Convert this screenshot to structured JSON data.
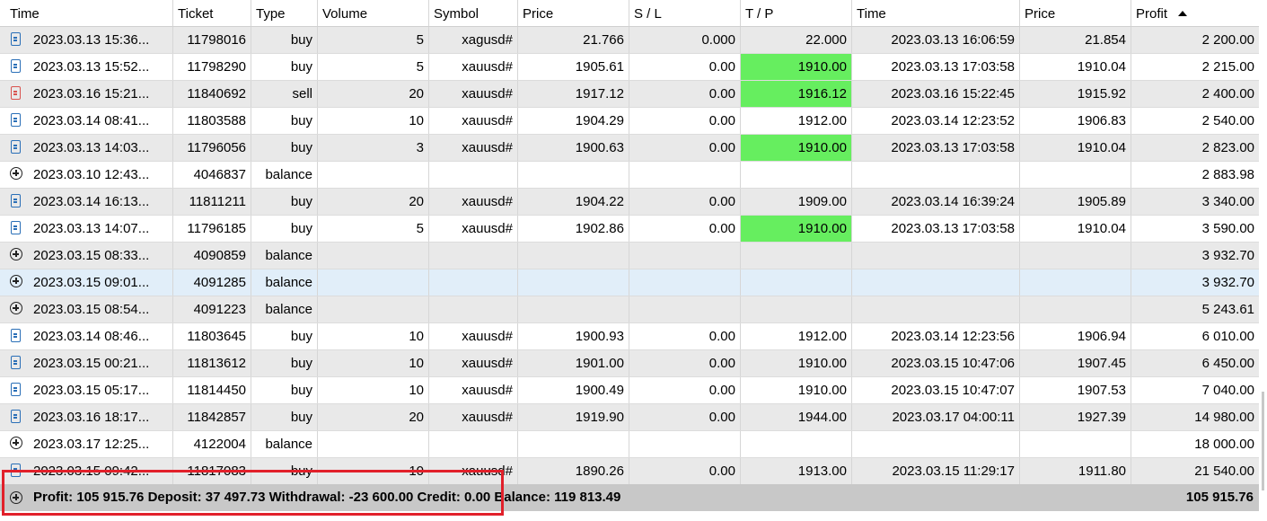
{
  "columns": [
    {
      "key": "time",
      "label": "Time",
      "align": "l"
    },
    {
      "key": "ticket",
      "label": "Ticket",
      "align": "r"
    },
    {
      "key": "type",
      "label": "Type",
      "align": "r"
    },
    {
      "key": "volume",
      "label": "Volume",
      "align": "r"
    },
    {
      "key": "symbol",
      "label": "Symbol",
      "align": "r"
    },
    {
      "key": "price",
      "label": "Price",
      "align": "r"
    },
    {
      "key": "sl",
      "label": "S / L",
      "align": "r"
    },
    {
      "key": "tp",
      "label": "T / P",
      "align": "r"
    },
    {
      "key": "close_time",
      "label": "Time",
      "align": "r"
    },
    {
      "key": "close_price",
      "label": "Price",
      "align": "r"
    },
    {
      "key": "profit",
      "label": "Profit",
      "align": "r"
    }
  ],
  "rows": [
    {
      "icon": "buy-doc-icon",
      "kind": "buy",
      "time": "2023.03.13 15:36...",
      "ticket": "11798016",
      "type": "buy",
      "volume": "5",
      "symbol": "xagusd#",
      "price": "21.766",
      "sl": "0.000",
      "tp": "22.000",
      "tp_hit": false,
      "close_time": "2023.03.13 16:06:59",
      "close_price": "21.854",
      "profit": "2 200.00"
    },
    {
      "icon": "buy-doc-icon",
      "kind": "buy",
      "time": "2023.03.13 15:52...",
      "ticket": "11798290",
      "type": "buy",
      "volume": "5",
      "symbol": "xauusd#",
      "price": "1905.61",
      "sl": "0.00",
      "tp": "1910.00",
      "tp_hit": true,
      "close_time": "2023.03.13 17:03:58",
      "close_price": "1910.04",
      "profit": "2 215.00"
    },
    {
      "icon": "sell-doc-icon",
      "kind": "sell",
      "time": "2023.03.16 15:21...",
      "ticket": "11840692",
      "type": "sell",
      "volume": "20",
      "symbol": "xauusd#",
      "price": "1917.12",
      "sl": "0.00",
      "tp": "1916.12",
      "tp_hit": true,
      "close_time": "2023.03.16 15:22:45",
      "close_price": "1915.92",
      "profit": "2 400.00"
    },
    {
      "icon": "buy-doc-icon",
      "kind": "buy",
      "time": "2023.03.14 08:41...",
      "ticket": "11803588",
      "type": "buy",
      "volume": "10",
      "symbol": "xauusd#",
      "price": "1904.29",
      "sl": "0.00",
      "tp": "1912.00",
      "tp_hit": false,
      "close_time": "2023.03.14 12:23:52",
      "close_price": "1906.83",
      "profit": "2 540.00"
    },
    {
      "icon": "buy-doc-icon",
      "kind": "buy",
      "time": "2023.03.13 14:03...",
      "ticket": "11796056",
      "type": "buy",
      "volume": "3",
      "symbol": "xauusd#",
      "price": "1900.63",
      "sl": "0.00",
      "tp": "1910.00",
      "tp_hit": true,
      "close_time": "2023.03.13 17:03:58",
      "close_price": "1910.04",
      "profit": "2 823.00"
    },
    {
      "icon": "plus-circle-icon",
      "kind": "balance",
      "time": "2023.03.10 12:43...",
      "ticket": "4046837",
      "type": "balance",
      "volume": "",
      "symbol": "",
      "price": "",
      "sl": "",
      "tp": "",
      "tp_hit": false,
      "close_time": "",
      "close_price": "",
      "profit": "2 883.98"
    },
    {
      "icon": "buy-doc-icon",
      "kind": "buy",
      "time": "2023.03.14 16:13...",
      "ticket": "11811211",
      "type": "buy",
      "volume": "20",
      "symbol": "xauusd#",
      "price": "1904.22",
      "sl": "0.00",
      "tp": "1909.00",
      "tp_hit": false,
      "close_time": "2023.03.14 16:39:24",
      "close_price": "1905.89",
      "profit": "3 340.00"
    },
    {
      "icon": "buy-doc-icon",
      "kind": "buy",
      "time": "2023.03.13 14:07...",
      "ticket": "11796185",
      "type": "buy",
      "volume": "5",
      "symbol": "xauusd#",
      "price": "1902.86",
      "sl": "0.00",
      "tp": "1910.00",
      "tp_hit": true,
      "close_time": "2023.03.13 17:03:58",
      "close_price": "1910.04",
      "profit": "3 590.00"
    },
    {
      "icon": "plus-circle-icon",
      "kind": "balance",
      "time": "2023.03.15 08:33...",
      "ticket": "4090859",
      "type": "balance",
      "volume": "",
      "symbol": "",
      "price": "",
      "sl": "",
      "tp": "",
      "tp_hit": false,
      "close_time": "",
      "close_price": "",
      "profit": "3 932.70"
    },
    {
      "icon": "plus-circle-icon",
      "kind": "balance",
      "selected": true,
      "time": "2023.03.15 09:01...",
      "ticket": "4091285",
      "type": "balance",
      "volume": "",
      "symbol": "",
      "price": "",
      "sl": "",
      "tp": "",
      "tp_hit": false,
      "close_time": "",
      "close_price": "",
      "profit": "3 932.70"
    },
    {
      "icon": "plus-circle-icon",
      "kind": "balance",
      "time": "2023.03.15 08:54...",
      "ticket": "4091223",
      "type": "balance",
      "volume": "",
      "symbol": "",
      "price": "",
      "sl": "",
      "tp": "",
      "tp_hit": false,
      "close_time": "",
      "close_price": "",
      "profit": "5 243.61"
    },
    {
      "icon": "buy-doc-icon",
      "kind": "buy",
      "time": "2023.03.14 08:46...",
      "ticket": "11803645",
      "type": "buy",
      "volume": "10",
      "symbol": "xauusd#",
      "price": "1900.93",
      "sl": "0.00",
      "tp": "1912.00",
      "tp_hit": false,
      "close_time": "2023.03.14 12:23:56",
      "close_price": "1906.94",
      "profit": "6 010.00"
    },
    {
      "icon": "buy-doc-icon",
      "kind": "buy",
      "time": "2023.03.15 00:21...",
      "ticket": "11813612",
      "type": "buy",
      "volume": "10",
      "symbol": "xauusd#",
      "price": "1901.00",
      "sl": "0.00",
      "tp": "1910.00",
      "tp_hit": false,
      "close_time": "2023.03.15 10:47:06",
      "close_price": "1907.45",
      "profit": "6 450.00"
    },
    {
      "icon": "buy-doc-icon",
      "kind": "buy",
      "time": "2023.03.15 05:17...",
      "ticket": "11814450",
      "type": "buy",
      "volume": "10",
      "symbol": "xauusd#",
      "price": "1900.49",
      "sl": "0.00",
      "tp": "1910.00",
      "tp_hit": false,
      "close_time": "2023.03.15 10:47:07",
      "close_price": "1907.53",
      "profit": "7 040.00"
    },
    {
      "icon": "buy-doc-icon",
      "kind": "buy",
      "time": "2023.03.16 18:17...",
      "ticket": "11842857",
      "type": "buy",
      "volume": "20",
      "symbol": "xauusd#",
      "price": "1919.90",
      "sl": "0.00",
      "tp": "1944.00",
      "tp_hit": false,
      "close_time": "2023.03.17 04:00:11",
      "close_price": "1927.39",
      "profit": "14 980.00"
    },
    {
      "icon": "plus-circle-icon",
      "kind": "balance",
      "time": "2023.03.17 12:25...",
      "ticket": "4122004",
      "type": "balance",
      "volume": "",
      "symbol": "",
      "price": "",
      "sl": "",
      "tp": "",
      "tp_hit": false,
      "close_time": "",
      "close_price": "",
      "profit": "18 000.00"
    },
    {
      "icon": "buy-doc-icon",
      "kind": "buy",
      "time": "2023.03.15 09:42...",
      "ticket": "11817083",
      "type": "buy",
      "volume": "10",
      "symbol": "xauusd#",
      "price": "1890.26",
      "sl": "0.00",
      "tp": "1913.00",
      "tp_hit": false,
      "close_time": "2023.03.15 11:29:17",
      "close_price": "1911.80",
      "profit": "21 540.00"
    }
  ],
  "summary": {
    "text": "Profit: 105 915.76  Deposit: 37 497.73  Withdrawal: -23 600.00  Credit: 0.00  Balance: 119 813.49",
    "total": "105 915.76"
  },
  "colors": {
    "tp_hit": "#66ee5f",
    "highlight_box": "#e1202a",
    "selected_row": "#e1eef9"
  }
}
